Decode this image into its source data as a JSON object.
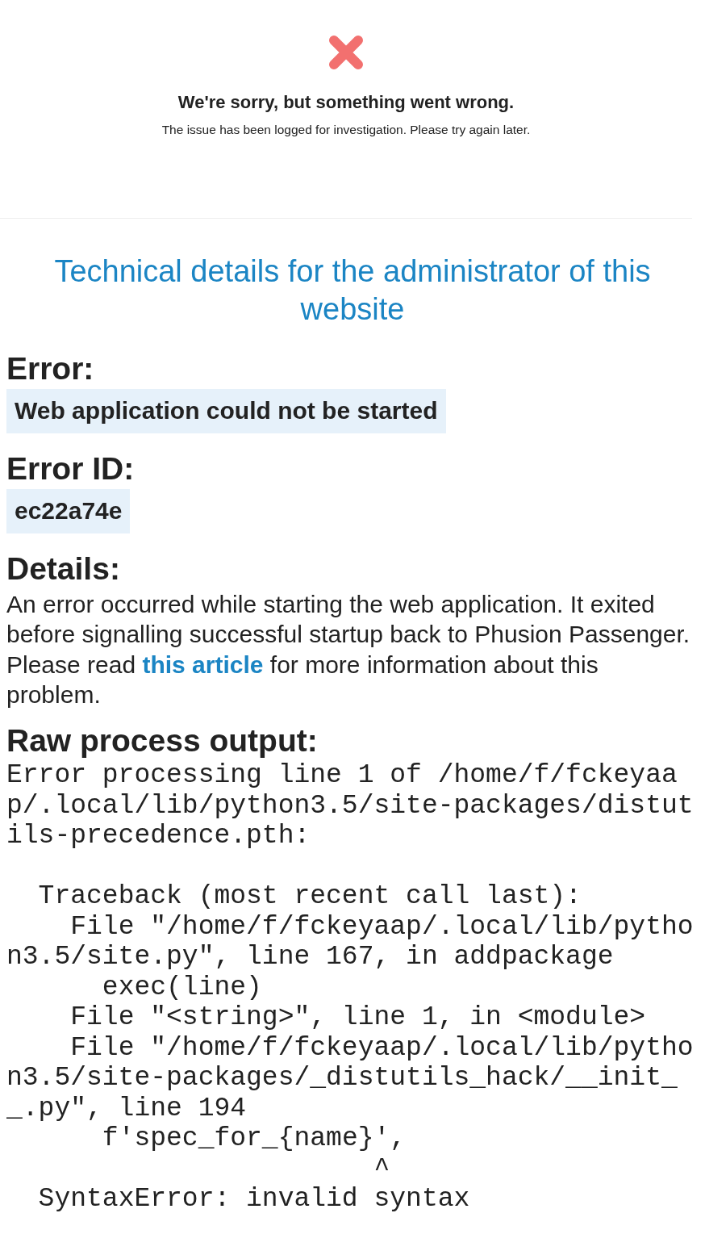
{
  "notice": {
    "title": "We're sorry, but something went wrong.",
    "message": "The issue has been logged for investigation. Please try again later."
  },
  "technical": {
    "heading": "Technical details for the administrator of this website",
    "sections": [
      {
        "kind": "code",
        "label": "Error:",
        "value": "Web application could not be started"
      },
      {
        "kind": "code",
        "label": "Error ID:",
        "value": "ec22a74e"
      },
      {
        "kind": "text",
        "label": "Details:",
        "before": "An error occurred while starting the web application. It exited before signalling successful startup back to Phusion Passenger. Please read ",
        "link": "this article",
        "after": " for more information about this problem."
      },
      {
        "kind": "output",
        "label": "Raw process output:",
        "value": "Error processing line 1 of /home/f/fckeyaap/.local/lib/python3.5/site-packages/distutils-precedence.pth:\n\n  Traceback (most recent call last):\n    File \"/home/f/fckeyaap/.local/lib/python3.5/site.py\", line 167, in addpackage\n      exec(line)\n    File \"<string>\", line 1, in <module>\n    File \"/home/f/fckeyaap/.local/lib/python3.5/site-packages/_distutils_hack/__init__.py\", line 194\n      f'spec_for_{name}',\n                       ^\n  SyntaxError: invalid syntax"
      }
    ]
  }
}
